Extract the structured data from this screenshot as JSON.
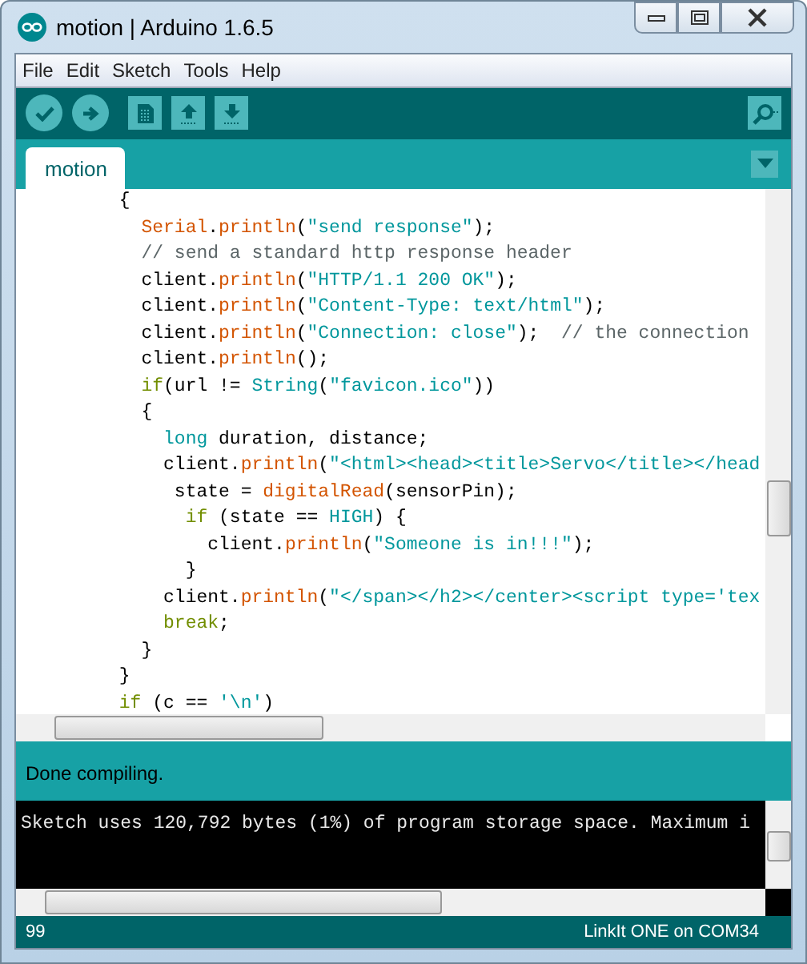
{
  "window": {
    "title": "motion | Arduino 1.6.5"
  },
  "menu": [
    "File",
    "Edit",
    "Sketch",
    "Tools",
    "Help"
  ],
  "tabs": [
    {
      "label": "motion",
      "selected": true
    }
  ],
  "editor": {
    "lines": [
      [
        {
          "kind": "plain",
          "t": "      {"
        }
      ],
      [
        {
          "kind": "fn",
          "t": "        Serial"
        },
        {
          "kind": "plain",
          "t": "."
        },
        {
          "kind": "fn",
          "t": "println"
        },
        {
          "kind": "plain",
          "t": "("
        },
        {
          "kind": "str",
          "t": "\"send response\""
        },
        {
          "kind": "plain",
          "t": ");"
        }
      ],
      [
        {
          "kind": "comment",
          "t": "        // send a standard http response header"
        }
      ],
      [
        {
          "kind": "plain",
          "t": "        client."
        },
        {
          "kind": "fn",
          "t": "println"
        },
        {
          "kind": "plain",
          "t": "("
        },
        {
          "kind": "str",
          "t": "\"HTTP/1.1 200 OK\""
        },
        {
          "kind": "plain",
          "t": ");"
        }
      ],
      [
        {
          "kind": "plain",
          "t": "        client."
        },
        {
          "kind": "fn",
          "t": "println"
        },
        {
          "kind": "plain",
          "t": "("
        },
        {
          "kind": "str",
          "t": "\"Content-Type: text/html\""
        },
        {
          "kind": "plain",
          "t": ");"
        }
      ],
      [
        {
          "kind": "plain",
          "t": "        client."
        },
        {
          "kind": "fn",
          "t": "println"
        },
        {
          "kind": "plain",
          "t": "("
        },
        {
          "kind": "str",
          "t": "\"Connection: close\""
        },
        {
          "kind": "plain",
          "t": ");"
        },
        {
          "kind": "comment",
          "t": "  // the connection"
        }
      ],
      [
        {
          "kind": "plain",
          "t": "        client."
        },
        {
          "kind": "fn",
          "t": "println"
        },
        {
          "kind": "plain",
          "t": "();"
        }
      ],
      [
        {
          "kind": "keyword",
          "t": "        if"
        },
        {
          "kind": "plain",
          "t": "(url != "
        },
        {
          "kind": "type",
          "t": "String"
        },
        {
          "kind": "plain",
          "t": "("
        },
        {
          "kind": "str",
          "t": "\"favicon.ico\""
        },
        {
          "kind": "plain",
          "t": "))"
        }
      ],
      [
        {
          "kind": "plain",
          "t": "        {"
        }
      ],
      [
        {
          "kind": "type",
          "t": "          long"
        },
        {
          "kind": "plain",
          "t": " duration, distance;"
        }
      ],
      [
        {
          "kind": "plain",
          "t": "          client."
        },
        {
          "kind": "fn",
          "t": "println"
        },
        {
          "kind": "plain",
          "t": "("
        },
        {
          "kind": "str",
          "t": "\"<html><head><title>Servo</title></head"
        }
      ],
      [
        {
          "kind": "plain",
          "t": "           state = "
        },
        {
          "kind": "fn",
          "t": "digitalRead"
        },
        {
          "kind": "plain",
          "t": "(sensorPin);"
        }
      ],
      [
        {
          "kind": "keyword",
          "t": "            if"
        },
        {
          "kind": "plain",
          "t": " (state == "
        },
        {
          "kind": "type",
          "t": "HIGH"
        },
        {
          "kind": "plain",
          "t": ") {"
        }
      ],
      [
        {
          "kind": "plain",
          "t": "              client."
        },
        {
          "kind": "fn",
          "t": "println"
        },
        {
          "kind": "plain",
          "t": "("
        },
        {
          "kind": "str",
          "t": "\"Someone is in!!!\""
        },
        {
          "kind": "plain",
          "t": ");"
        }
      ],
      [
        {
          "kind": "plain",
          "t": "            }"
        }
      ],
      [
        {
          "kind": "plain",
          "t": "          client."
        },
        {
          "kind": "fn",
          "t": "println"
        },
        {
          "kind": "plain",
          "t": "("
        },
        {
          "kind": "str",
          "t": "\"</span></h2></center><script type='tex"
        }
      ],
      [
        {
          "kind": "keyword",
          "t": "          break"
        },
        {
          "kind": "plain",
          "t": ";"
        }
      ],
      [
        {
          "kind": "plain",
          "t": "        }"
        }
      ],
      [
        {
          "kind": "plain",
          "t": "      }"
        }
      ],
      [
        {
          "kind": "keyword",
          "t": "      if"
        },
        {
          "kind": "plain",
          "t": " (c == "
        },
        {
          "kind": "str",
          "t": "'\\n'"
        },
        {
          "kind": "plain",
          "t": ")"
        }
      ]
    ]
  },
  "message": "Done compiling.",
  "console": {
    "lines": [
      "Sketch uses 120,792 bytes (1%) of program storage space. Maximum i"
    ]
  },
  "status_bar": {
    "line": "99",
    "board": "LinkIt ONE on COM34"
  }
}
